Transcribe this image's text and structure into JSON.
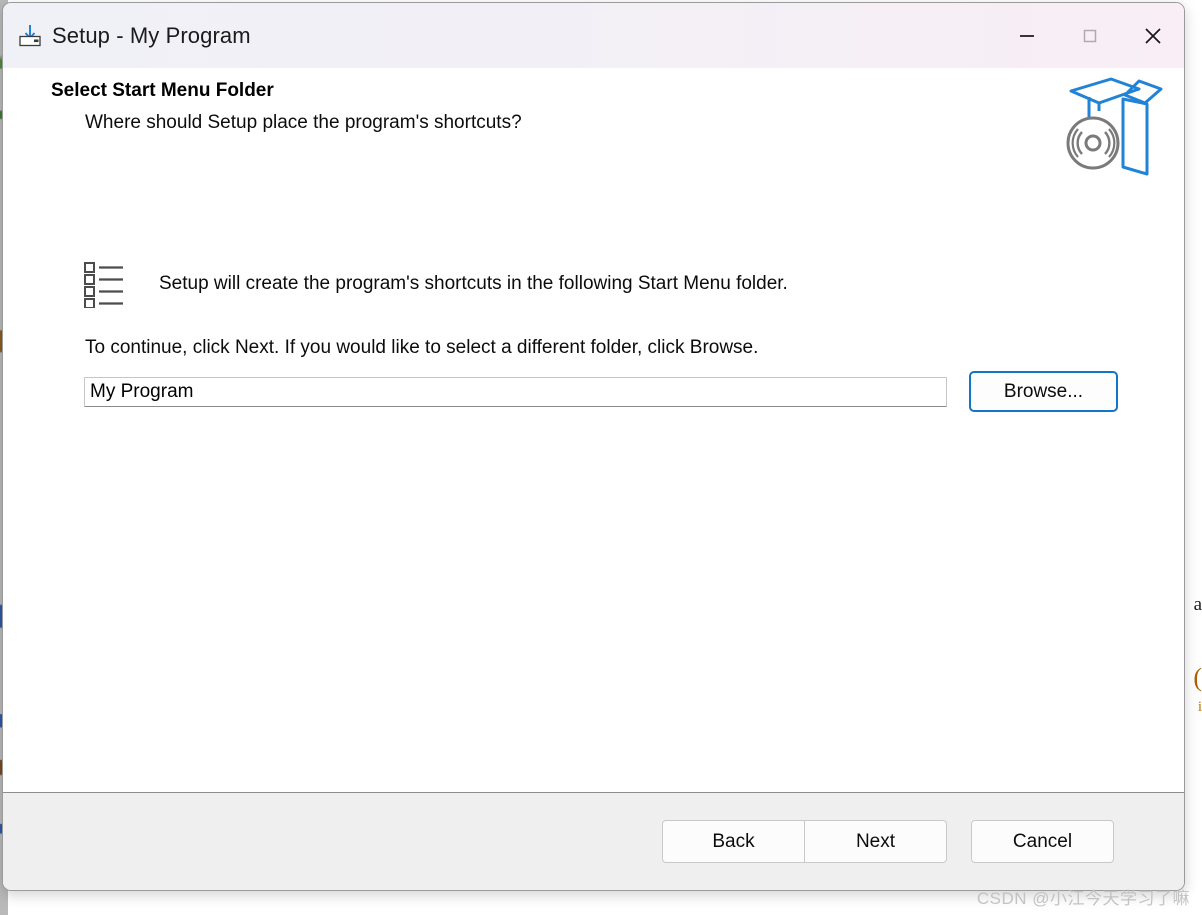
{
  "window": {
    "title": "Setup - My Program",
    "icon": "install-download-icon",
    "controls": [
      {
        "name": "minimize-button",
        "glyph": "minimize"
      },
      {
        "name": "maximize-button",
        "glyph": "maximize"
      },
      {
        "name": "close-button",
        "glyph": "close"
      }
    ]
  },
  "page": {
    "title": "Select Start Menu Folder",
    "subtitle": "Where should Setup place the program's shortcuts?",
    "art_icon": "setup-box-with-disc-icon"
  },
  "content": {
    "list_icon": "bulleted-list-icon",
    "shortcut_text": "Setup will create the program's shortcuts in the following Start Menu folder.",
    "continue_text": "To continue, click Next. If you would like to select a different folder, click Browse.",
    "folder_field": {
      "value": "My Program",
      "placeholder": "My Program"
    },
    "browse_label": "Browse..."
  },
  "footer": {
    "back_label": "Back",
    "next_label": "Next",
    "cancel_label": "Cancel"
  },
  "watermark": "CSDN @小江今天学习了嘛",
  "colors": {
    "titlebar_left": "#f0f1f7",
    "titlebar_right": "#f9eef5",
    "accent_blue": "#1275c8",
    "art_blue": "#2183d6",
    "art_gray": "#7a7a7a",
    "footer_bg": "#efefef",
    "window_border": "#9b9b9b",
    "watermark_gray": "#c3c3c3"
  },
  "background_glyphs": {
    "g1": "a",
    "g2": "(",
    "g3": "i"
  }
}
